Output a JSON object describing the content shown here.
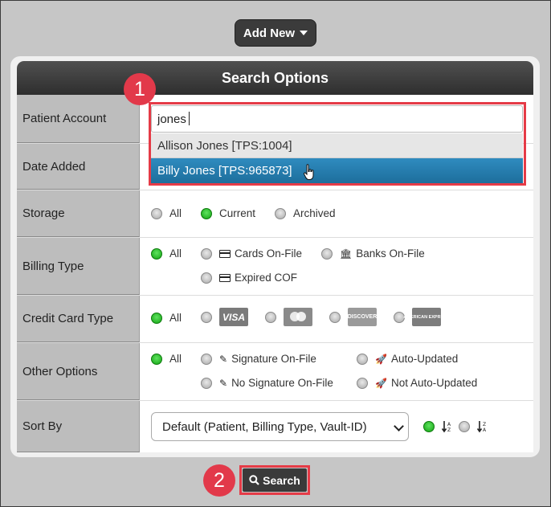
{
  "add_new": {
    "label": "Add New"
  },
  "panel": {
    "title": "Search Options"
  },
  "rows": {
    "patient_account": {
      "label": "Patient Account",
      "value": "jones"
    },
    "date_added": {
      "label": "Date Added"
    },
    "storage": {
      "label": "Storage",
      "options": [
        "All",
        "Current",
        "Archived"
      ],
      "selected": "Current"
    },
    "billing_type": {
      "label": "Billing Type",
      "options": [
        "All",
        "Cards On-File",
        "Banks On-File",
        "Expired COF"
      ],
      "selected": "All"
    },
    "credit_card_type": {
      "label": "Credit Card Type",
      "options": [
        "All",
        "VISA",
        "MasterCard",
        "DISCOVER",
        "AMERICAN EXPRESS"
      ],
      "selected": "All"
    },
    "other_options": {
      "label": "Other Options",
      "options": [
        "All",
        "Signature On-File",
        "Auto-Updated",
        "No Signature On-File",
        "Not Auto-Updated"
      ],
      "selected": "All"
    },
    "sort_by": {
      "label": "Sort By",
      "value": "Default (Patient, Billing Type, Vault-ID)",
      "directions": [
        "ascending",
        "descending"
      ],
      "selected": "ascending"
    }
  },
  "autocomplete": [
    {
      "label": "Allison Jones [TPS:1004]"
    },
    {
      "label": "Billy Jones [TPS:965873]"
    }
  ],
  "callouts": [
    "1",
    "2"
  ],
  "search_button": {
    "label": "Search"
  },
  "icons": {
    "search": "search-icon",
    "card": "credit-card-icon",
    "bank": "bank-icon",
    "pen": "pen-icon",
    "rocket": "rocket-icon",
    "sort_asc": "sort-alpha-asc-icon",
    "sort_desc": "sort-alpha-desc-icon",
    "caret": "caret-down-icon",
    "cursor": "hand-cursor-icon"
  },
  "colors": {
    "accent_red": "#e2394a",
    "selected_green": "#13a313",
    "highlight_blue": "#2f8bbf",
    "header_dark": "#3b3b3b"
  }
}
